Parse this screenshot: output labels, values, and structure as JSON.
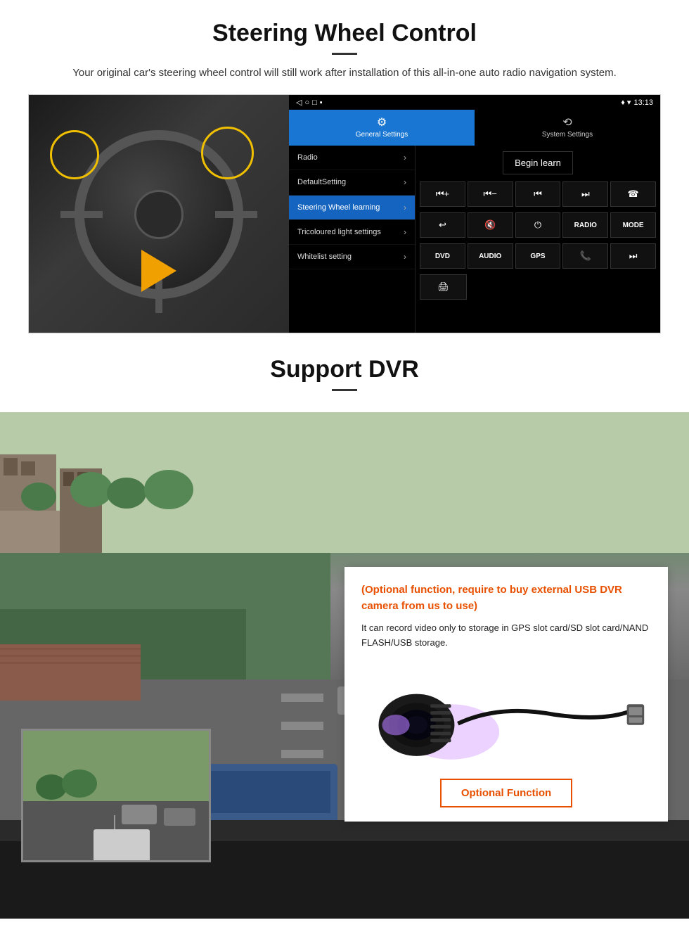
{
  "steering": {
    "title": "Steering Wheel Control",
    "subtitle": "Your original car's steering wheel control will still work after installation of this all-in-one auto radio navigation system.",
    "android": {
      "statusbar": {
        "time": "13:13",
        "signal_icon": "▼",
        "wifi_icon": "▾",
        "battery_icon": "▪"
      },
      "tabs": [
        {
          "label": "General Settings",
          "icon": "⚙",
          "active": true
        },
        {
          "label": "System Settings",
          "icon": "⟲",
          "active": false
        }
      ],
      "menu_items": [
        {
          "label": "Radio",
          "active": false
        },
        {
          "label": "DefaultSetting",
          "active": false
        },
        {
          "label": "Steering Wheel learning",
          "active": true
        },
        {
          "label": "Tricoloured light settings",
          "active": false
        },
        {
          "label": "Whitelist setting",
          "active": false
        }
      ],
      "begin_learn_label": "Begin learn",
      "ctrl_buttons": [
        "⏮+",
        "⏮-",
        "⏮⏮",
        "⏭⏭",
        "☎",
        "↩",
        "🔇x",
        "⏻",
        "RADIO",
        "MODE",
        "DVD",
        "AUDIO",
        "GPS",
        "📞⏮",
        "⏭⏭"
      ],
      "bottom_icon": "🖨"
    }
  },
  "dvr": {
    "title": "Support DVR",
    "optional_text": "(Optional function, require to buy external USB DVR camera from us to use)",
    "description": "It can record video only to storage in GPS slot card/SD slot card/NAND FLASH/USB storage.",
    "optional_button_label": "Optional Function"
  }
}
